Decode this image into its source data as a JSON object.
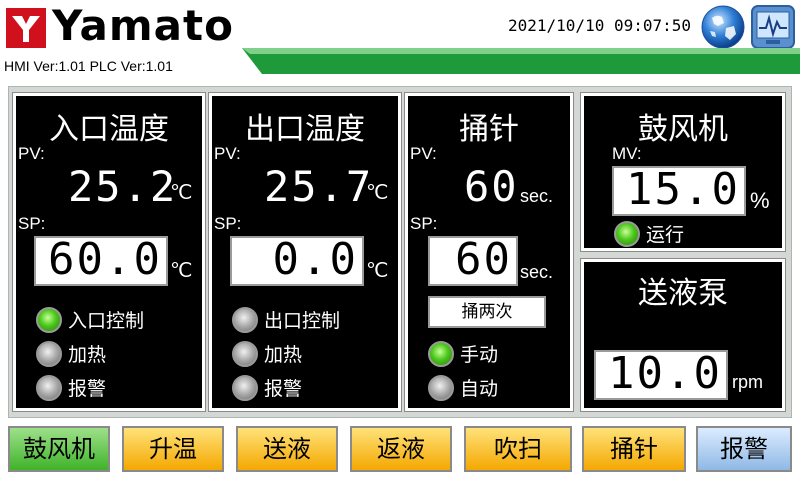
{
  "header": {
    "brand": "Yamato",
    "datetime": "2021/10/10  09:07:50",
    "version": "HMI Ver:1.01  PLC Ver:1.01",
    "icons": [
      "globe-icon",
      "monitor-icon"
    ],
    "logo_color": "#d0101c",
    "band_color": "#1f9a3a"
  },
  "panels": {
    "inlet": {
      "title": "入口温度",
      "pv_label": "PV:",
      "pv_value": "25.2",
      "pv_unit": "℃",
      "sp_label": "SP:",
      "sp_value": "60.0",
      "sp_unit": "℃",
      "lamps": [
        {
          "label": "入口控制",
          "state": "on"
        },
        {
          "label": "加热",
          "state": "off"
        },
        {
          "label": "报警",
          "state": "off"
        }
      ]
    },
    "outlet": {
      "title": "出口温度",
      "pv_label": "PV:",
      "pv_value": "25.7",
      "pv_unit": "℃",
      "sp_label": "SP:",
      "sp_value": "0.0",
      "sp_unit": "℃",
      "lamps": [
        {
          "label": "出口控制",
          "state": "off"
        },
        {
          "label": "加热",
          "state": "off"
        },
        {
          "label": "报警",
          "state": "off"
        }
      ]
    },
    "needle": {
      "title": "捅针",
      "pv_label": "PV:",
      "pv_value": "60",
      "pv_unit": "sec.",
      "sp_label": "SP:",
      "sp_value": "60",
      "sp_unit": "sec.",
      "twice_button": "捅两次",
      "lamps": [
        {
          "label": "手动",
          "state": "on"
        },
        {
          "label": "自动",
          "state": "off"
        }
      ]
    },
    "blower": {
      "title": "鼓风机",
      "mv_label": "MV:",
      "mv_value": "15.0",
      "mv_unit": "%",
      "lamp": {
        "label": "运行",
        "state": "on"
      }
    },
    "pump": {
      "title": "送液泵",
      "value": "10.0",
      "unit": "rpm"
    }
  },
  "buttons": [
    {
      "label": "鼓风机",
      "color": "green"
    },
    {
      "label": "升温",
      "color": "orange"
    },
    {
      "label": "送液",
      "color": "orange"
    },
    {
      "label": "返液",
      "color": "orange"
    },
    {
      "label": "吹扫",
      "color": "orange"
    },
    {
      "label": "捅针",
      "color": "orange"
    },
    {
      "label": "报警",
      "color": "blue"
    }
  ]
}
